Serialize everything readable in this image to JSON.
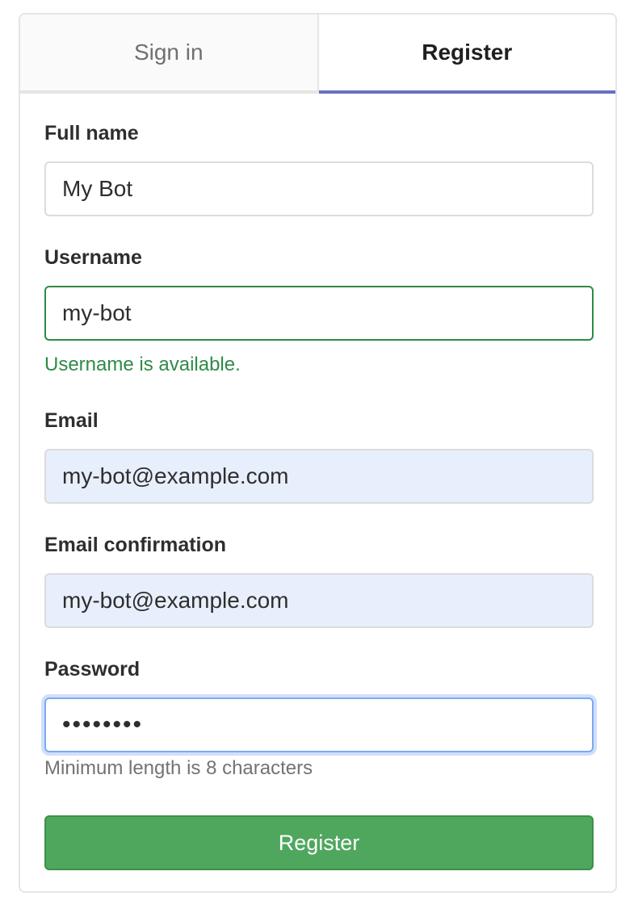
{
  "tabs": [
    {
      "label": "Sign in",
      "active": false
    },
    {
      "label": "Register",
      "active": true
    }
  ],
  "form": {
    "full_name": {
      "label": "Full name",
      "value": "My Bot"
    },
    "username": {
      "label": "Username",
      "value": "my-bot",
      "status": "Username is available."
    },
    "email": {
      "label": "Email",
      "value": "my-bot@example.com"
    },
    "email_confirmation": {
      "label": "Email confirmation",
      "value": "my-bot@example.com"
    },
    "password": {
      "label": "Password",
      "value": "••••••••",
      "help": "Minimum length is 8 characters"
    },
    "submit_label": "Register"
  },
  "colors": {
    "active_tab_accent": "#6b6fc2",
    "success": "#2e8b46",
    "submit_button": "#4fa75e",
    "autofill_background": "#e8effc"
  }
}
